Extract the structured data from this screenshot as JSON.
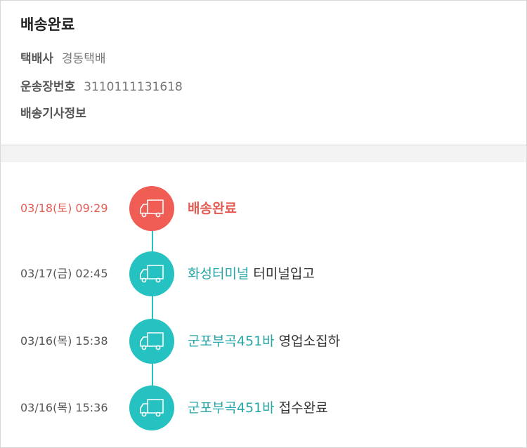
{
  "status_title": "배송완료",
  "info": {
    "courier_label": "택배사",
    "courier_value": "경동택배",
    "tracking_label": "운송장번호",
    "tracking_value": "3110111131618",
    "driver_label": "배송기사정보"
  },
  "colors": {
    "current": "#f05d54",
    "past": "#26c1c1",
    "location_text": "#26a6a6"
  },
  "events": [
    {
      "time": "03/18(토) 09:29",
      "location": "배송완료",
      "action": "",
      "icon": "truck-icon",
      "current": true
    },
    {
      "time": "03/17(금) 02:45",
      "location": "화성터미널",
      "action": "터미널입고",
      "icon": "truck-icon",
      "current": false
    },
    {
      "time": "03/16(목) 15:38",
      "location": "군포부곡451바",
      "action": "영업소집하",
      "icon": "truck-icon",
      "current": false
    },
    {
      "time": "03/16(목) 15:36",
      "location": "군포부곡451바",
      "action": "접수완료",
      "icon": "truck-icon",
      "current": false
    }
  ]
}
